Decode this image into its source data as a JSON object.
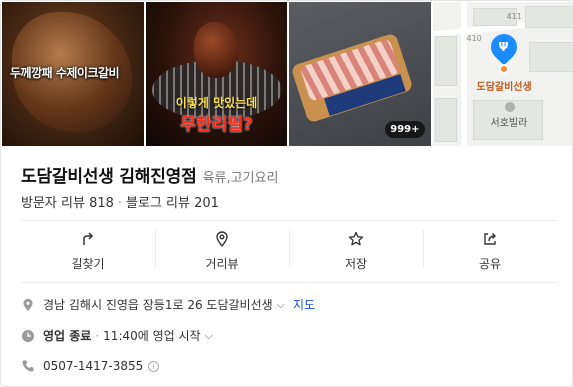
{
  "photos": {
    "photo1_caption": "두께깡패 수제이크갈비",
    "photo2_caption_line1": "이렇게 맛있는데",
    "photo2_caption_line2": "무한리필?",
    "photo_count_badge": "999+",
    "map": {
      "block_numbers": [
        "411",
        "410"
      ],
      "pin_label": "도담갈비선생",
      "nearby_label": "서호빌라"
    }
  },
  "place": {
    "name": "도담갈비선생 김해진영점",
    "category": "육류,고기요리",
    "visitor_reviews": "방문자 리뷰 818",
    "separator": "·",
    "blog_reviews": "블로그 리뷰 201"
  },
  "actions": [
    {
      "label": "길찾기",
      "icon": "directions-icon"
    },
    {
      "label": "거리뷰",
      "icon": "street-view-icon"
    },
    {
      "label": "저장",
      "icon": "star-icon"
    },
    {
      "label": "공유",
      "icon": "share-icon"
    }
  ],
  "info": {
    "address": "경남 김해시 진영읍 장등1로 26 도담갈비선생",
    "map_link": "지도",
    "hours_status": "영업 종료",
    "hours_sep": "·",
    "hours_next": "11:40에 영업 시작",
    "phone": "0507-1417-3855"
  },
  "colors": {
    "link": "#1a4fd6",
    "pin": "#1a8cff",
    "map_label": "#c2581a"
  }
}
